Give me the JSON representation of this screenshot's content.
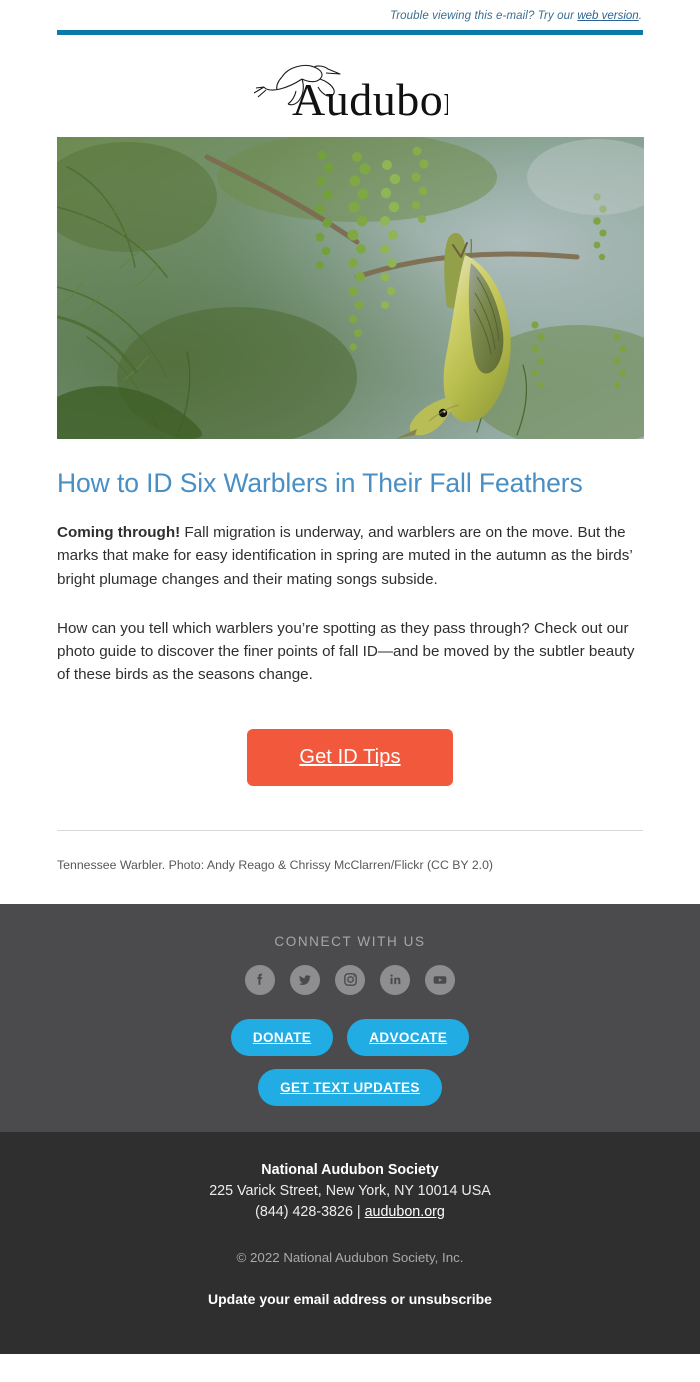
{
  "preheader": {
    "text_before": "Trouble viewing this e-mail? Try our ",
    "link_label": "web version",
    "text_after": "."
  },
  "brand": {
    "name": "Audubon",
    "logo_icon": "egret-bird-icon",
    "accent_teal": "#0b7aa8"
  },
  "hero": {
    "alt": "Tennessee Warbler hanging upside down on green conifer foliage"
  },
  "article": {
    "headline": "How to ID Six Warblers in Their Fall Feathers",
    "paragraph1_bold": "Coming through!",
    "paragraph1_rest": " Fall migration is underway, and warblers are on the move. But the marks that make for easy identification in spring are muted in the autumn as the birds’ bright plumage changes and their mating songs subside.",
    "paragraph2": "How can you tell which warblers you’re spotting as they pass through? Check out our photo guide to discover the finer points of fall ID—and be moved by the subtler beauty of these birds as the seasons change.",
    "cta_label": "Get ID Tips",
    "cta_color": "#f2593c",
    "photo_credit": "Tennessee Warbler. Photo: Andy Reago & Chrissy McClarren/Flickr (CC BY 2.0)"
  },
  "social": {
    "heading": "CONNECT WITH US",
    "icons": [
      {
        "name": "facebook-icon",
        "label": "Facebook"
      },
      {
        "name": "twitter-icon",
        "label": "Twitter"
      },
      {
        "name": "instagram-icon",
        "label": "Instagram"
      },
      {
        "name": "linkedin-icon",
        "label": "LinkedIn"
      },
      {
        "name": "youtube-icon",
        "label": "YouTube"
      }
    ],
    "buttons": [
      {
        "label": "DONATE"
      },
      {
        "label": "ADVOCATE"
      },
      {
        "label": "GET TEXT UPDATES"
      }
    ],
    "button_color": "#21ace3"
  },
  "footer": {
    "org": "National Audubon Society",
    "address": "225 Varick Street, New York, NY 10014 USA",
    "phone": "(844) 428-3826",
    "separator": " | ",
    "website": "audubon.org",
    "copyright": "© 2022 National Audubon Society, Inc.",
    "unsubscribe": "Update your email address or unsubscribe"
  }
}
